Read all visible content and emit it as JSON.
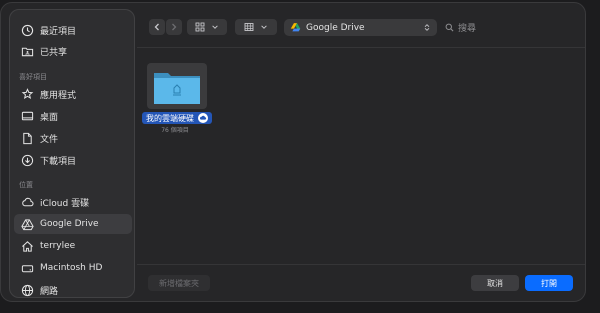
{
  "sidebar": {
    "items_top": [
      {
        "label": "最近項目",
        "icon": "clock-icon"
      },
      {
        "label": "已共享",
        "icon": "shared-folder-icon"
      }
    ],
    "favorites_title": "喜好項目",
    "favorites": [
      {
        "label": "應用程式",
        "icon": "applications-icon"
      },
      {
        "label": "桌面",
        "icon": "desktop-icon"
      },
      {
        "label": "文件",
        "icon": "document-icon"
      },
      {
        "label": "下載項目",
        "icon": "download-icon"
      }
    ],
    "locations_title": "位置",
    "locations": [
      {
        "label": "iCloud 雲碟",
        "icon": "cloud-icon"
      },
      {
        "label": "Google Drive",
        "icon": "google-drive-icon",
        "selected": true
      },
      {
        "label": "terrylee",
        "icon": "home-icon"
      },
      {
        "label": "Macintosh HD",
        "icon": "harddrive-icon"
      },
      {
        "label": "網路",
        "icon": "globe-icon"
      }
    ]
  },
  "toolbar": {
    "location": "Google Drive",
    "search_placeholder": "搜尋"
  },
  "content": {
    "folder_name": "我的雲端硬碟",
    "folder_count": "76 個項目"
  },
  "footer": {
    "new_folder": "新增檔案夾",
    "cancel": "取消",
    "open": "打開"
  },
  "colors": {
    "accent": "#0a6cff",
    "folder": "#5bb8ea"
  }
}
